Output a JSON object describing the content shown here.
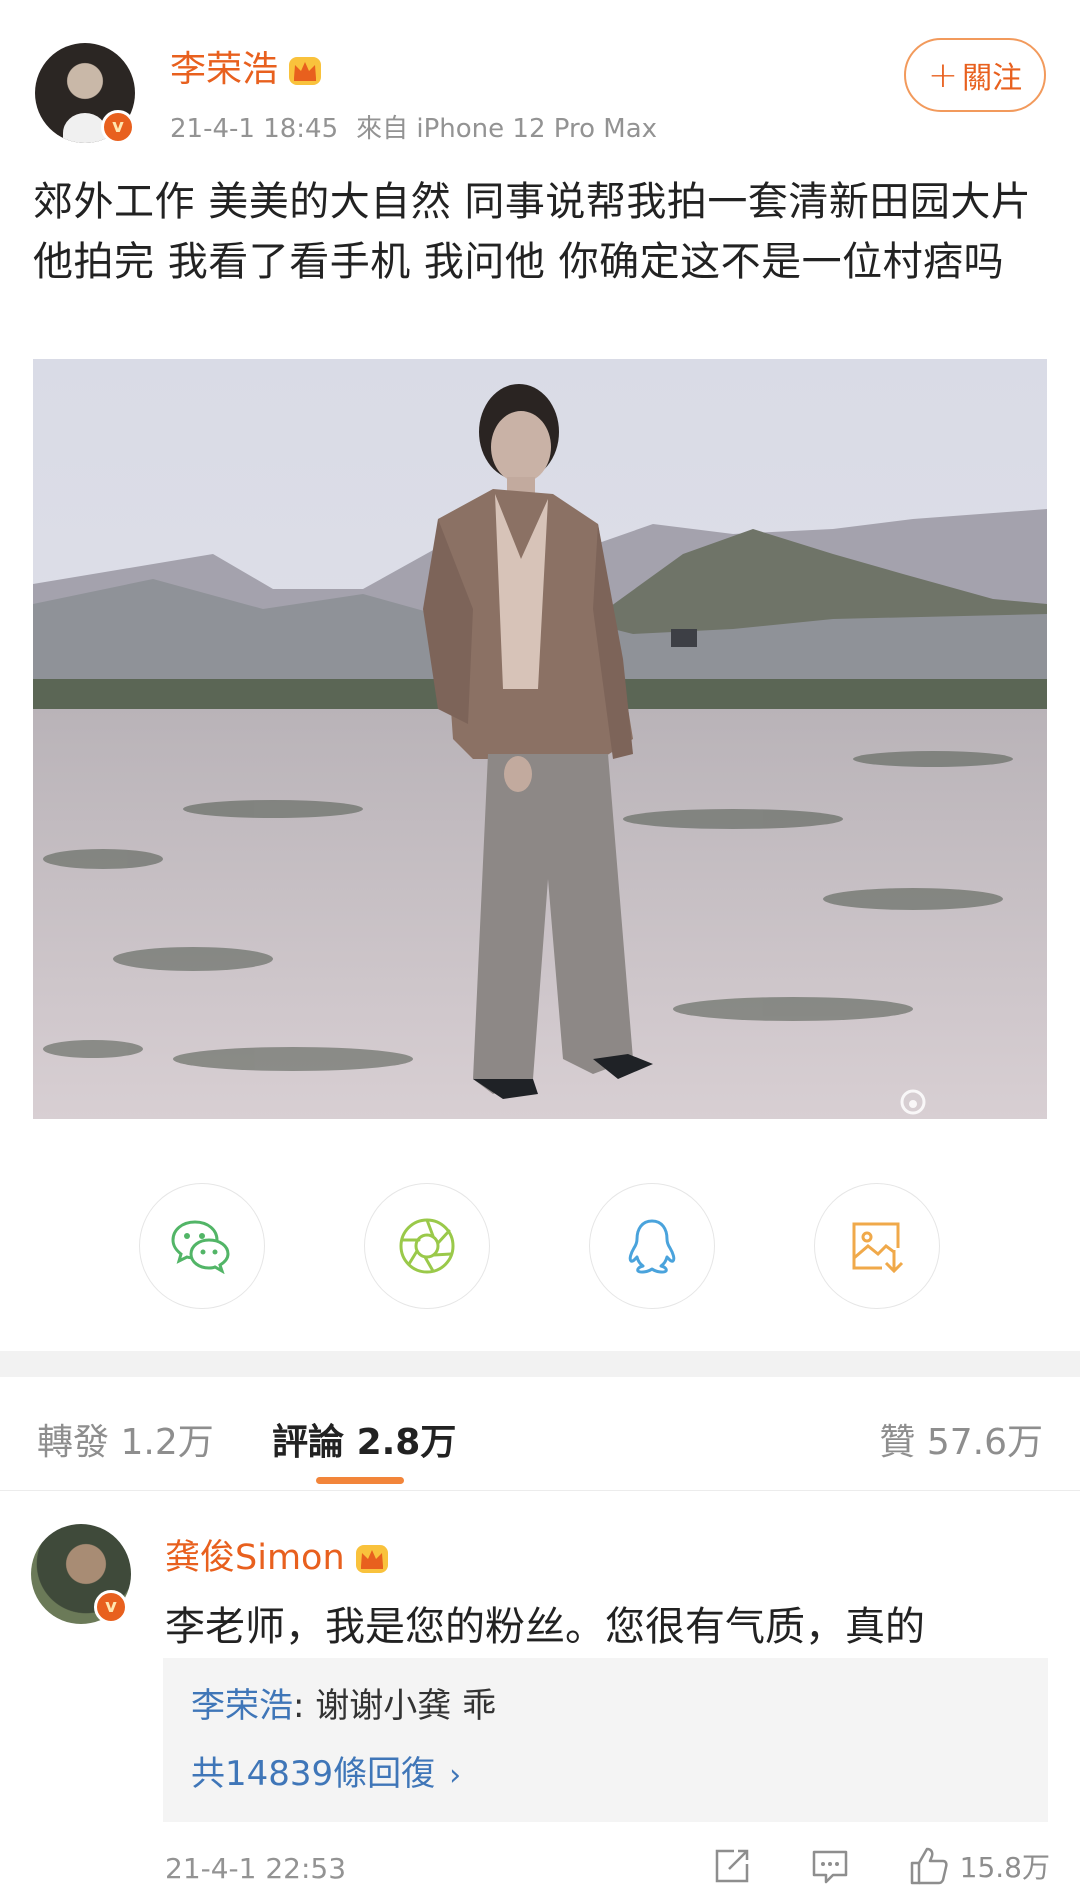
{
  "post": {
    "author": "李荣浩",
    "time": "21-4-1 18:45",
    "source": "來自 iPhone 12 Pro Max",
    "follow_label": "關注",
    "text": "郊外工作 美美的大自然 同事说帮我拍一套清新田园大片 他拍完 我看了看手机 我问他 你确定这不是一位村痞吗",
    "badge_letter": "v"
  },
  "share": [
    {
      "name": "wechat-icon"
    },
    {
      "name": "moments-icon"
    },
    {
      "name": "qq-icon"
    },
    {
      "name": "save-image-icon"
    }
  ],
  "tabs": {
    "repost_label": "轉發",
    "repost_count": "1.2万",
    "comment_label": "評論",
    "comment_count": "2.8万",
    "like_label": "贊",
    "like_count": "57.6万"
  },
  "comment": {
    "user": "龚俊Simon",
    "text": "李老师，我是您的粉丝。您很有气质，真的",
    "reply_user": "李荣浩",
    "reply_text": ": 谢谢小龚 乖",
    "reply_more": "共14839條回復",
    "time": "21-4-1 22:53",
    "like_count": "15.8万"
  },
  "colors": {
    "accent": "#e8601e",
    "link": "#3f76b8",
    "tab_underline": "#f2853a"
  }
}
